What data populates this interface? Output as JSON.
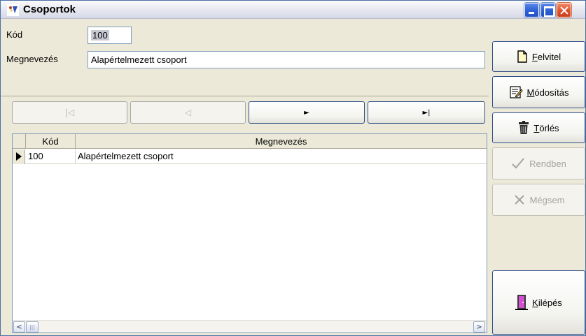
{
  "window": {
    "title": "Csoportok",
    "icon": "app-icon",
    "controls": [
      "minimize-icon",
      "maximize-icon",
      "close-icon"
    ]
  },
  "form": {
    "kod_label": "Kód",
    "kod_value": "100",
    "megnevezes_label": "Megnevezés",
    "megnevezes_value": "Alapértelmezett csoport"
  },
  "navigator": {
    "first": "|◁",
    "prev": "◁",
    "next": "►",
    "last": "►|"
  },
  "grid": {
    "columns": [
      "Kód",
      "Megnevezés"
    ],
    "rows": [
      {
        "kod": "100",
        "megnevezes": "Alapértelmezett csoport"
      }
    ],
    "scroll_left": "<",
    "scroll_right": ">",
    "thumb_grip": "|||"
  },
  "buttons": {
    "felvitel": {
      "first": "F",
      "rest": "elvitel"
    },
    "modositas": {
      "first": "M",
      "rest": "ódosítás"
    },
    "torles": {
      "first": "T",
      "rest": "örlés"
    },
    "rendben": "Rendben",
    "megsem": "Mégsem",
    "kilepes": {
      "first": "K",
      "rest": "ilépés"
    }
  },
  "colors": {
    "window_bg": "#ece9d8",
    "titlebar_close": "#e0502c",
    "button_border": "#2f4e8a"
  }
}
